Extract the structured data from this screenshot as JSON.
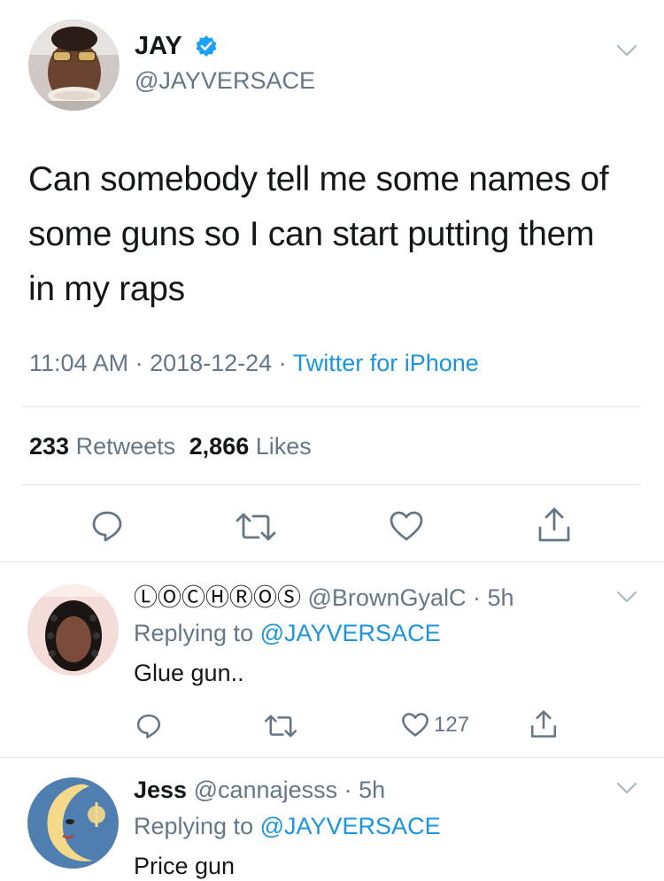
{
  "tweet": {
    "author_name": "JAY",
    "author_handle": "@JAYVERSACE",
    "verified": true,
    "text_lines": [
      "Can somebody tell me some names of",
      "some guns so I can start putting them",
      "in my raps"
    ],
    "time": "11:04 AM",
    "date": "2018-12-24",
    "source": "Twitter for iPhone",
    "sep": " · ",
    "retweets_count": "233",
    "retweets_label": "Retweets",
    "likes_count": "2,866",
    "likes_label": "Likes"
  },
  "replies": [
    {
      "display_name": "ⓁⓄⒸⒽⓇⓄⓈ",
      "handle": "@BrownGyalC",
      "time": "5h",
      "replying_prefix": "Replying to",
      "replying_to": "@JAYVERSACE",
      "text": "Glue gun..",
      "like_count": "127"
    },
    {
      "display_name": "Jess",
      "handle": "@cannajesss",
      "time": "5h",
      "replying_prefix": "Replying to",
      "replying_to": "@JAYVERSACE",
      "text": "Price gun"
    }
  ],
  "colors": {
    "link": "#1b95e0",
    "muted": "#657786",
    "text": "#14171a",
    "divider": "#e1e8ed",
    "verified": "#1da1f2"
  }
}
